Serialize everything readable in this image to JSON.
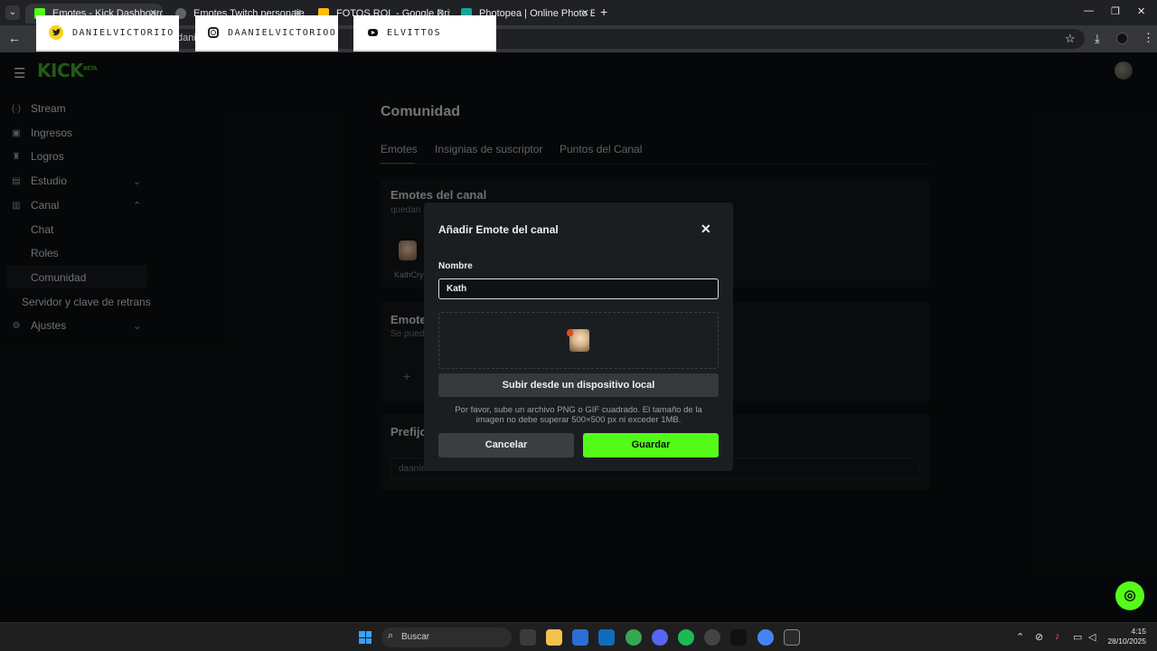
{
  "browser": {
    "tabs": [
      {
        "title": "Emotes - Kick Dashboard",
        "active": true,
        "favicon_color": "#53fc18"
      },
      {
        "title": "Emotes Twitch personaje",
        "active": false,
        "favicon_color": "#9aa0a6"
      },
      {
        "title": "FOTOS ROL - Google Drive",
        "active": false,
        "favicon_color": "#fbbc04"
      },
      {
        "title": "Photopea | Online Photo Editor",
        "active": false,
        "favicon_color": "#18a497"
      }
    ],
    "address_fragment": "danie"
  },
  "overlay": {
    "twitter": "DANIELVICTORIIO",
    "instagram": "DAANIELVICTORIOO",
    "youtube": "ELVITTOS"
  },
  "header": {
    "logo": "KICK",
    "logo_badge": "BETA"
  },
  "sidebar": {
    "items": [
      {
        "label": "Stream",
        "icon": "broadcast-icon"
      },
      {
        "label": "Ingresos",
        "icon": "wallet-icon"
      },
      {
        "label": "Logros",
        "icon": "trophy-icon"
      },
      {
        "label": "Estudio",
        "icon": "studio-icon",
        "expanded": false
      },
      {
        "label": "Canal",
        "icon": "channel-icon",
        "expanded": true
      }
    ],
    "canal_sub": [
      "Chat",
      "Roles",
      "Comunidad"
    ],
    "extra": "Servidor y clave de retrans",
    "settings": "Ajustes"
  },
  "content": {
    "title": "Comunidad",
    "tabs": [
      "Emotes",
      "Insignias de suscriptor",
      "Puntos del Canal"
    ],
    "channel_emotes_title": "Emotes del canal",
    "channel_emotes_sub": "quedan",
    "emote_name": "KathCry",
    "second_section_title": "Emote",
    "second_section_sub": "Se pued",
    "prefix_title": "Prefijo",
    "prefix_value": "daaniel"
  },
  "modal": {
    "title": "Añadir Emote del canal",
    "name_label": "Nombre",
    "name_value": "Kath",
    "upload_label": "Subir desde un dispositivo local",
    "help": "Por favor, sube un archivo PNG o GIF cuadrado. El tamaño de la imagen no debe superar 500×500 px ni exceder 1MB.",
    "cancel_label": "Cancelar",
    "save_label": "Guardar"
  },
  "taskbar": {
    "search_placeholder": "Buscar",
    "time": "4:15",
    "date": "28/10/2025"
  },
  "colors": {
    "accent": "#53fc18",
    "background": "#0b0e10",
    "modal": "#1b1e21"
  }
}
